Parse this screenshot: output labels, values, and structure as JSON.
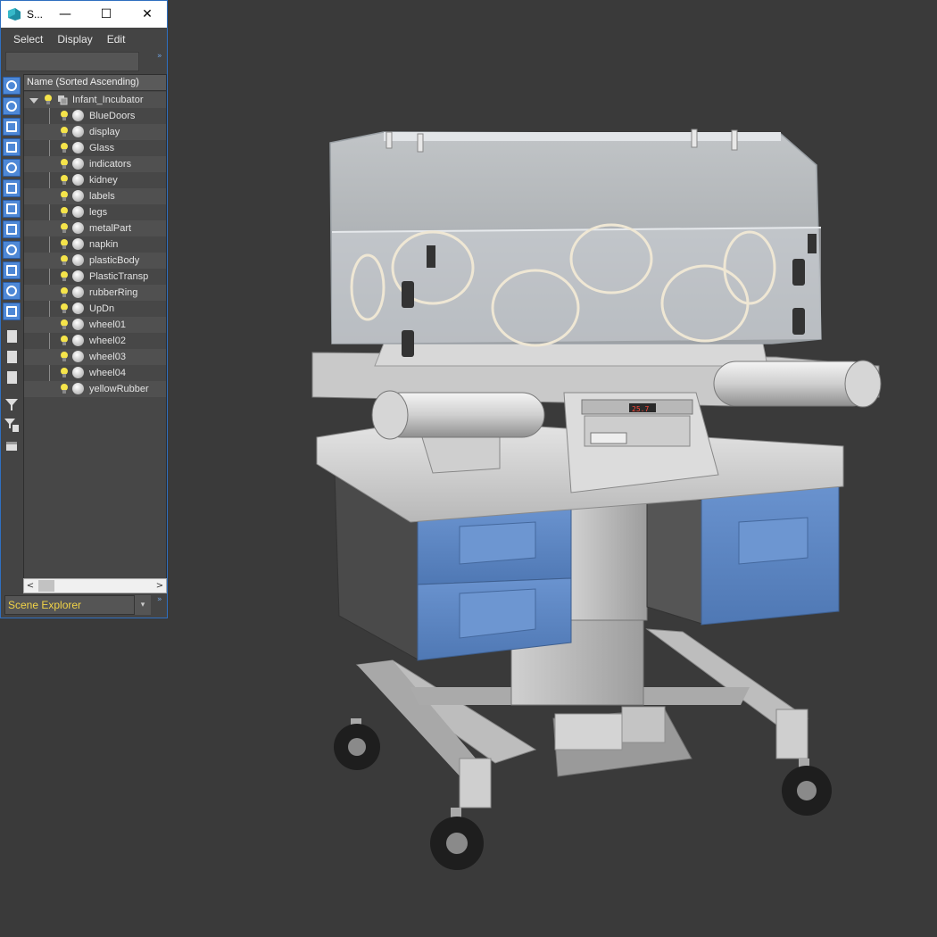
{
  "window": {
    "title": "S...",
    "minimize_glyph": "—",
    "maximize_glyph": "☐",
    "close_glyph": "✕"
  },
  "menu": {
    "items": [
      "Select",
      "Display",
      "Edit"
    ]
  },
  "search": {
    "value": "",
    "expand_glyph": "»"
  },
  "list": {
    "header": "Name (Sorted Ascending)",
    "root": "Infant_Incubator",
    "children": [
      "BlueDoors",
      "display",
      "Glass",
      "indicators",
      "kidney",
      "labels",
      "legs",
      "metalPart",
      "napkin",
      "plasticBody",
      "PlasticTransp",
      "rubberRing",
      "UpDn",
      "wheel01",
      "wheel02",
      "wheel03",
      "wheel04",
      "yellowRubber"
    ]
  },
  "scrollbar": {
    "left_glyph": "<",
    "right_glyph": ">"
  },
  "footer": {
    "explorer_name": "Scene Explorer",
    "dropdown_glyph": "▾",
    "expand_glyph": "»"
  },
  "display_panel": {
    "temperature": "25.7"
  },
  "toolbar_icons": [
    "display-none-icon",
    "display-geometry-icon",
    "display-shapes-icon",
    "display-lights-icon",
    "display-cameras-icon",
    "display-helpers-icon",
    "display-spacewarps-icon",
    "display-groups-icon",
    "display-xrefs-icon",
    "display-bones-icon",
    "display-containers-icon",
    "display-all-icon",
    "display-list-icon",
    "display-invert-icon",
    "display-sel-icon",
    "filter-icon",
    "filter-settings-icon",
    "layer-icon"
  ],
  "colors": {
    "viewport_bg": "#3a3a3a",
    "drawer_blue": "#5b86c4",
    "window_border": "#2f6fc0",
    "explorer_text": "#f2d447"
  }
}
